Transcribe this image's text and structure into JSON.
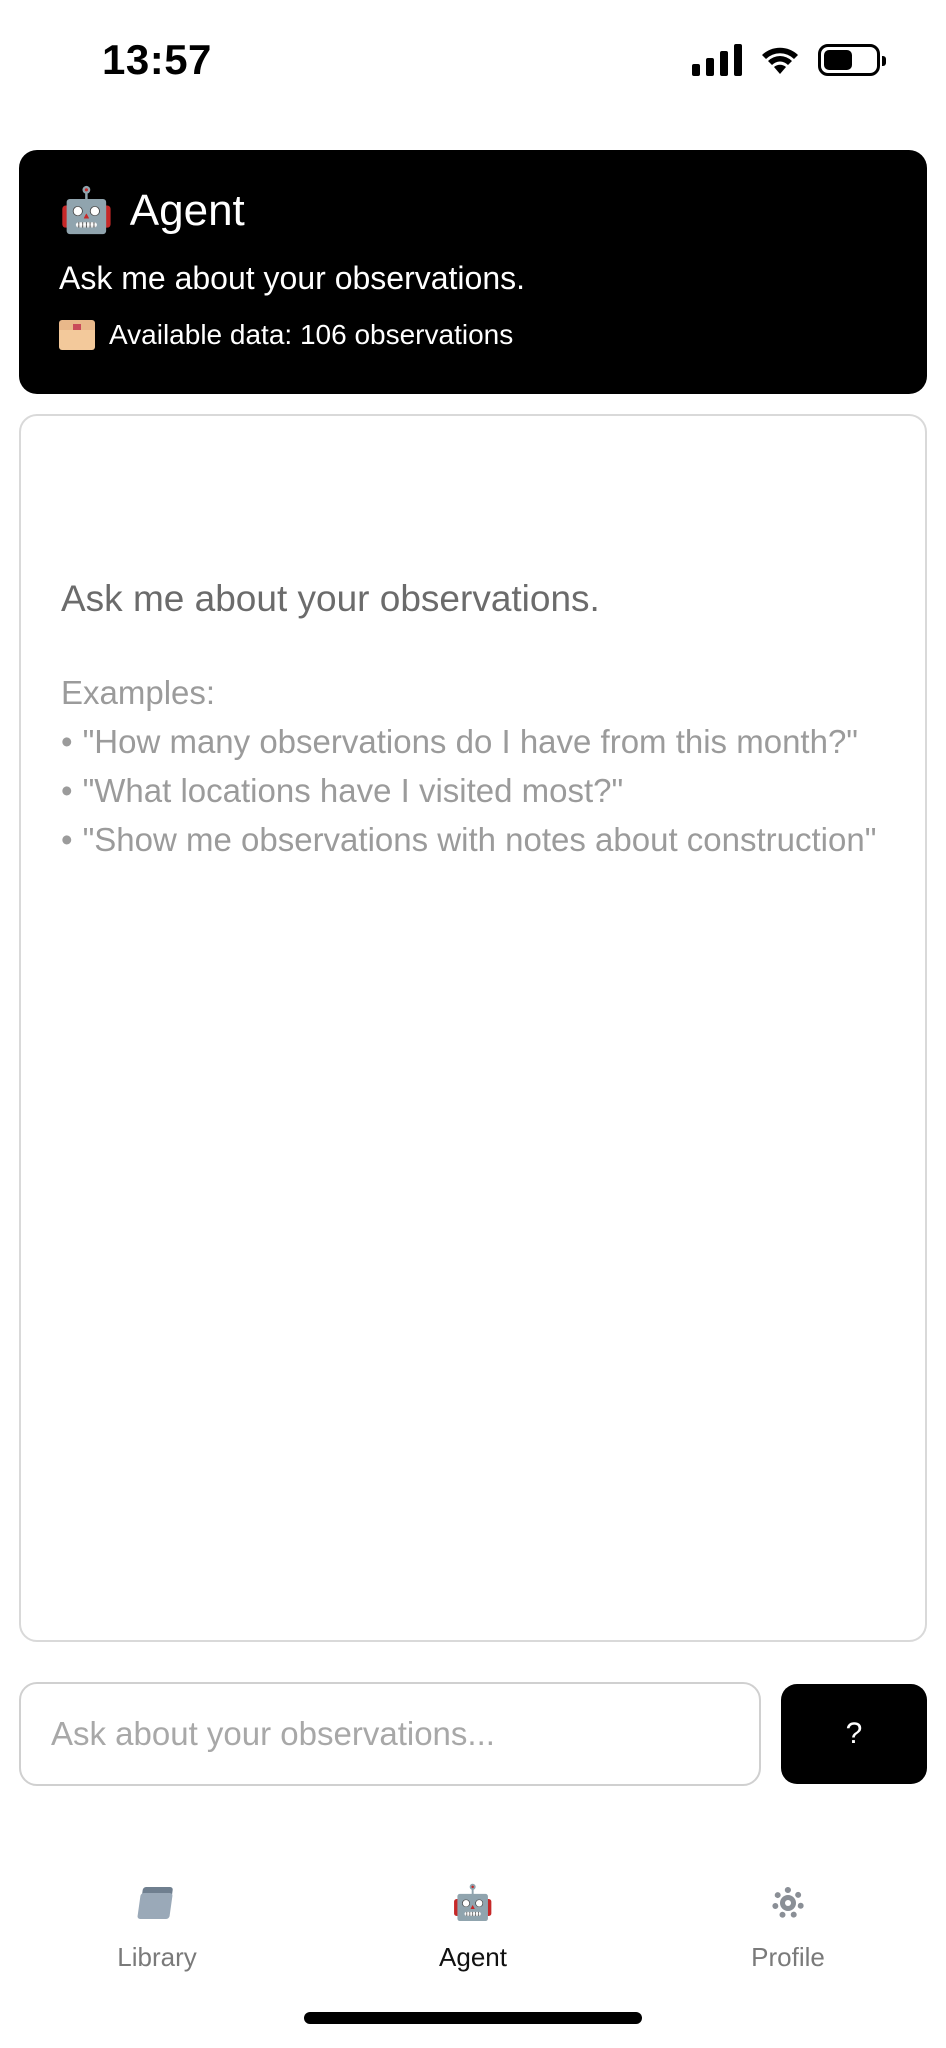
{
  "status_bar": {
    "time": "13:57"
  },
  "header": {
    "icon": "robot-emoji",
    "title": "Agent",
    "subtitle": "Ask me about your observations.",
    "data_icon": "card-file-box-emoji",
    "available_data": "Available data: 106 observations"
  },
  "chat": {
    "intro": "Ask me about your observations.",
    "examples_label": "Examples:",
    "examples": [
      "\"How many observations do I have from this month?\"",
      "\"What locations have I visited most?\"",
      "\"Show me observations with notes about construction\""
    ]
  },
  "input": {
    "placeholder": "Ask about your observations...",
    "value": "",
    "submit_label": "?"
  },
  "tabs": [
    {
      "label": "Library",
      "icon": "folder-icon",
      "active": false
    },
    {
      "label": "Agent",
      "icon": "robot-icon",
      "active": true
    },
    {
      "label": "Profile",
      "icon": "gear-icon",
      "active": false
    }
  ],
  "colors": {
    "header_bg": "#000000",
    "button_bg": "#000000",
    "border": "#d9d9d9",
    "muted_text": "#9b9b9b"
  }
}
